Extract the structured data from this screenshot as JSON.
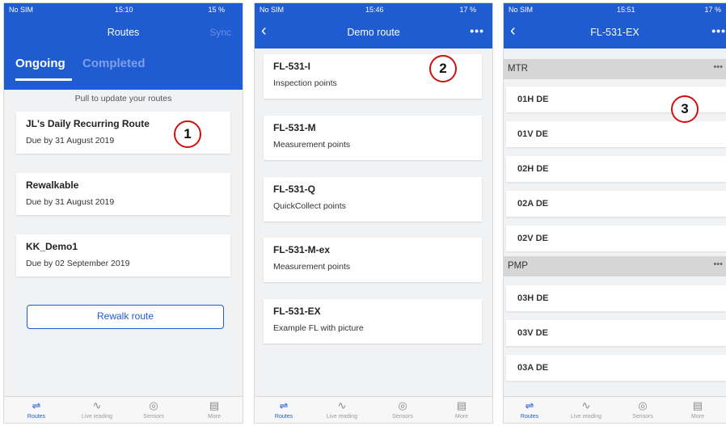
{
  "screen1": {
    "status": {
      "carrier": "No SIM",
      "time": "15:10",
      "battery": "15 %"
    },
    "title": "Routes",
    "sync": "Sync",
    "tabs": [
      "Ongoing",
      "Completed"
    ],
    "pull_text": "Pull to update your routes",
    "routes": [
      {
        "name": "JL's Daily Recurring Route",
        "due": "Due by 31 August 2019"
      },
      {
        "name": "Rewalkable",
        "due": "Due by 31 August 2019"
      },
      {
        "name": "KK_Demo1",
        "due": "Due by 02 September 2019"
      }
    ],
    "rewalk": "Rewalk route",
    "callout": "1"
  },
  "screen2": {
    "status": {
      "carrier": "No SIM",
      "time": "15:46",
      "battery": "17 %"
    },
    "title": "Demo route",
    "items": [
      {
        "name": "FL-531-I",
        "desc": "Inspection points"
      },
      {
        "name": "FL-531-M",
        "desc": "Measurement points"
      },
      {
        "name": "FL-531-Q",
        "desc": "QuickCollect points"
      },
      {
        "name": "FL-531-M-ex",
        "desc": "Measurement points"
      },
      {
        "name": "FL-531-EX",
        "desc": "Example FL with picture"
      }
    ],
    "callout": "2"
  },
  "screen3": {
    "status": {
      "carrier": "No SIM",
      "time": "15:51",
      "battery": "17 %"
    },
    "title": "FL-531-EX",
    "groups": [
      {
        "name": "MTR",
        "points": [
          "01H DE",
          "01V DE",
          "02H DE",
          "02A DE",
          "02V DE"
        ]
      },
      {
        "name": "PMP",
        "points": [
          "03H DE",
          "03V DE",
          "03A DE"
        ]
      }
    ],
    "callout": "3"
  },
  "tabbar": {
    "items": [
      {
        "label": "Routes",
        "icon": "routes-icon"
      },
      {
        "label": "Live reading",
        "icon": "pulse-icon"
      },
      {
        "label": "Sensors",
        "icon": "sensor-icon"
      },
      {
        "label": "More",
        "icon": "list-icon"
      }
    ]
  },
  "colors": {
    "primary": "#1f5bd1",
    "callout": "#d01010",
    "background": "#f1f2f4"
  }
}
